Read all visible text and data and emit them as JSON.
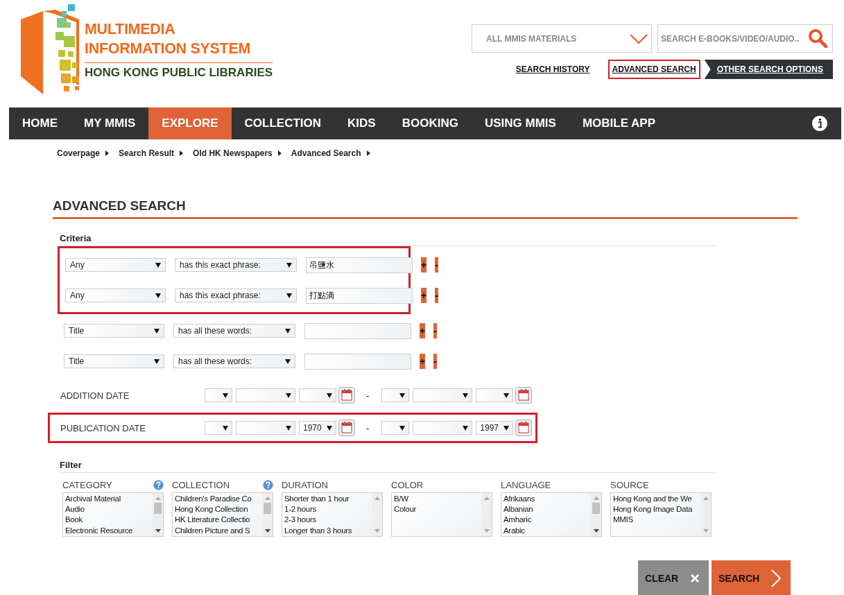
{
  "logo": {
    "line_1": "MULTIMEDIA",
    "line_2": "INFORMATION SYSTEM",
    "line_3": "HONG KONG PUBLIC LIBRARIES"
  },
  "scope_dropdown": {
    "value": "ALL MMIS MATERIALS"
  },
  "search": {
    "placeholder": "SEARCH E-BOOKS/VIDEO/AUDIO.."
  },
  "header_links": [
    {
      "label": "SEARCH HISTORY",
      "highlighted": false,
      "kind": "plain"
    },
    {
      "label": "ADVANCED SEARCH",
      "highlighted": true,
      "kind": "plain"
    },
    {
      "label": "OTHER SEARCH OPTIONS",
      "highlighted": false,
      "kind": "tab"
    }
  ],
  "nav": [
    {
      "label": "HOME",
      "selected": false
    },
    {
      "label": "MY MMIS",
      "selected": false
    },
    {
      "label": "EXPLORE",
      "selected": true
    },
    {
      "label": "COLLECTION",
      "selected": false
    },
    {
      "label": "KIDS",
      "selected": false
    },
    {
      "label": "BOOKING",
      "selected": false
    },
    {
      "label": "USING MMIS",
      "selected": false
    },
    {
      "label": "MOBILE APP",
      "selected": false
    }
  ],
  "breadcrumb": [
    "Coverpage",
    "Search Result",
    "Old HK Newspapers",
    "Advanced Search"
  ],
  "heading": "ADVANCED SEARCH",
  "criteria": {
    "title": "Criteria",
    "groups": [
      {
        "highlighted": true,
        "rows": [
          {
            "field": "Any",
            "operator": "has this exact phrase:",
            "value": "吊鹽水",
            "add_label": "+",
            "remove_label": "-"
          },
          {
            "field": "Any",
            "operator": "has this exact phrase:",
            "value": "打點滴",
            "add_label": "+",
            "remove_label": "-"
          }
        ]
      },
      {
        "highlighted": false,
        "rows": [
          {
            "field": "Title",
            "operator": "has all these words:",
            "add_label": "+",
            "remove_label": "-"
          },
          {
            "field": "Title",
            "operator": "has all these words:",
            "add_label": "+",
            "remove_label": "-"
          }
        ]
      }
    ]
  },
  "dates": [
    {
      "label": "ADDITION DATE",
      "highlighted": false,
      "separator": "-"
    },
    {
      "label": "PUBLICATION DATE",
      "highlighted": true,
      "separator": "-",
      "from": {
        "year": "1970"
      },
      "to": {
        "year": "1997"
      }
    }
  ],
  "filter": {
    "title": "Filter",
    "lists": [
      {
        "label": "CATEGORY",
        "help": true,
        "scrollable": true,
        "items": [
          "Archival Material",
          "Audio",
          "Book",
          "Electronic Resource"
        ]
      },
      {
        "label": "COLLECTION",
        "help": true,
        "scrollable": true,
        "items": [
          "Children's Paradise Co",
          "Hong Kong Collection",
          "HK Literature Collectio",
          "Children Picture and S"
        ]
      },
      {
        "label": "DURATION",
        "help": false,
        "scrollable": false,
        "items": [
          "Shorter than 1 hour",
          "1-2 hours",
          "2-3 hours",
          "Longer than 3 hours"
        ]
      },
      {
        "label": "COLOR",
        "help": false,
        "scrollable": false,
        "items": [
          "B/W",
          "Colour"
        ]
      },
      {
        "label": "LANGUAGE",
        "help": false,
        "scrollable": true,
        "items": [
          "Afrikaans",
          "Albanian",
          "Amharic",
          "Arabic"
        ]
      },
      {
        "label": "SOURCE",
        "help": false,
        "scrollable": false,
        "items": [
          "Hong Kong and the We",
          "Hong Kong Image Data",
          "MMIS"
        ]
      }
    ]
  },
  "actions": [
    {
      "label": "CLEAR",
      "kind": "clear"
    },
    {
      "label": "SEARCH",
      "kind": "submit"
    }
  ]
}
